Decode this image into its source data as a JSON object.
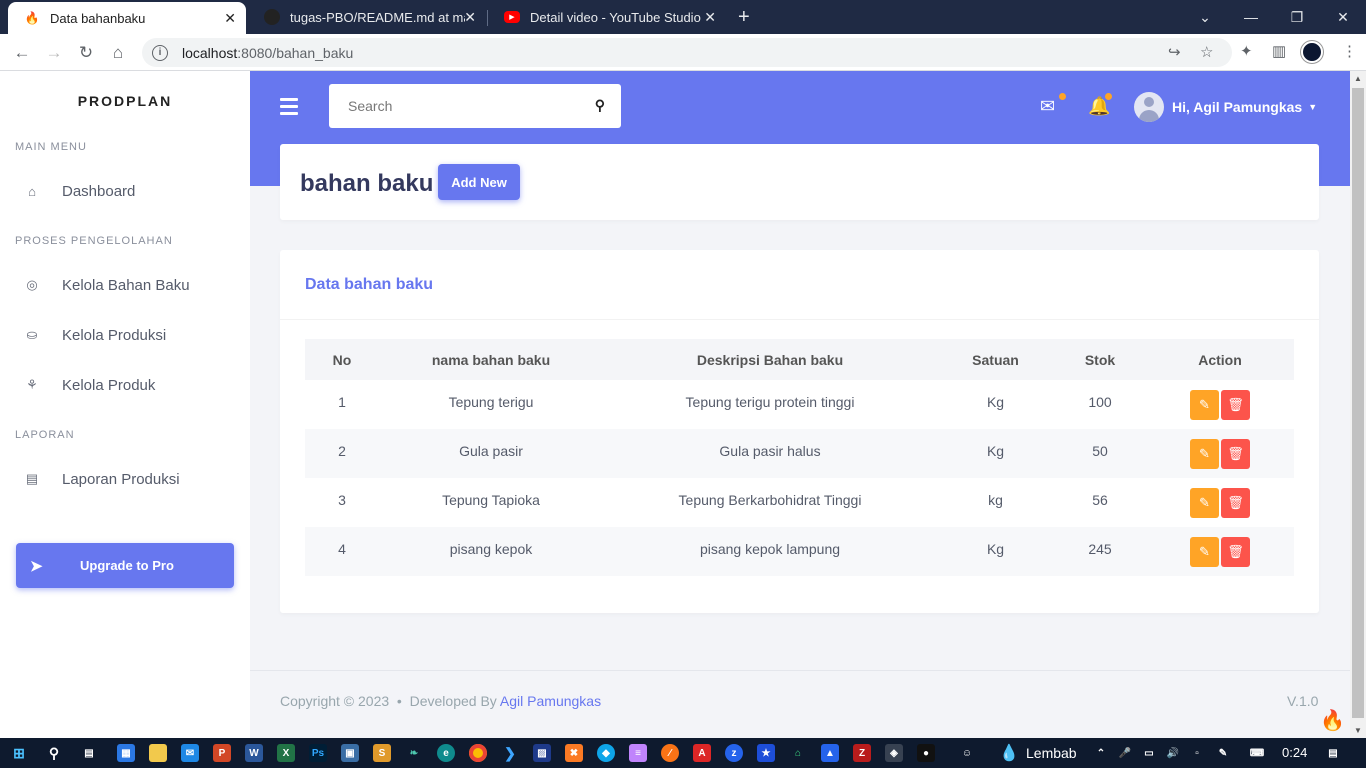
{
  "browser": {
    "tabs": [
      {
        "title": "Data bahanbaku",
        "active": true
      },
      {
        "title": "tugas-PBO/README.md at maste",
        "active": false
      },
      {
        "title": "Detail video - YouTube Studio",
        "active": false
      }
    ],
    "url_host": "localhost",
    "url_path": ":8080/bahan_baku"
  },
  "sidebar": {
    "brand": "PRODPLAN",
    "sections": {
      "main_menu": "MAIN MENU",
      "proses": "PROSES PENGELOLAHAN",
      "laporan": "LAPORAN"
    },
    "items": [
      {
        "label": "Dashboard",
        "icon": "home-icon"
      },
      {
        "label": "Kelola Bahan Baku",
        "icon": "gear-icon"
      },
      {
        "label": "Kelola Produksi",
        "icon": "cart-icon"
      },
      {
        "label": "Kelola Produk",
        "icon": "boxes-icon"
      },
      {
        "label": "Laporan Produksi",
        "icon": "report-icon"
      }
    ],
    "upgrade_label": "Upgrade to Pro"
  },
  "header": {
    "search_placeholder": "Search",
    "user_greeting": "Hi, Agil Pamungkas"
  },
  "page": {
    "title": "bahan baku",
    "add_label": "Add New",
    "card_title": "Data bahan baku"
  },
  "table": {
    "columns": [
      "No",
      "nama bahan baku",
      "Deskripsi Bahan baku",
      "Satuan",
      "Stok",
      "Action"
    ],
    "rows": [
      [
        "1",
        "Tepung terigu",
        "Tepung terigu protein tinggi",
        "Kg",
        "100"
      ],
      [
        "2",
        "Gula pasir",
        "Gula pasir halus",
        "Kg",
        "50"
      ],
      [
        "3",
        "Tepung Tapioka",
        "Tepung Berkarbohidrat Tinggi",
        "kg",
        "56"
      ],
      [
        "4",
        "pisang kepok",
        "pisang kepok lampung",
        "Kg",
        "245"
      ]
    ]
  },
  "footer": {
    "copyright": "Copyright © 2023",
    "developed_by": "Developed By",
    "author": "Agil Pamungkas",
    "version": "V.1.0"
  },
  "taskbar": {
    "weather": "Lembab",
    "time": "0:24"
  },
  "colors": {
    "primary": "#6777ef",
    "warning": "#ffa426",
    "danger": "#fc544b"
  }
}
